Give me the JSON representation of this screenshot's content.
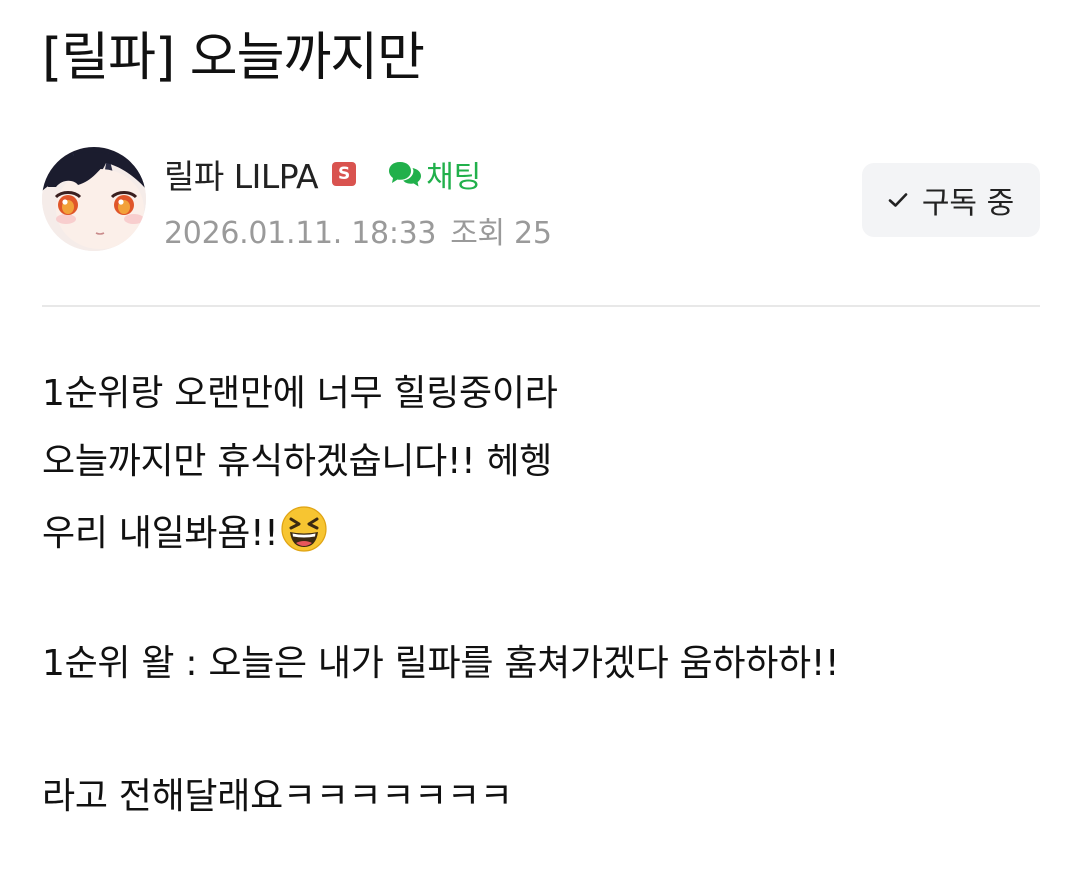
{
  "post": {
    "title": "[릴파] 오늘까지만",
    "author": {
      "name": "릴파 LILPA",
      "badge": "S",
      "badge_color": "#d9534f"
    },
    "chat_label": "채팅",
    "chat_color": "#21b04b",
    "date": "2026.01.11. 18:33",
    "views": "조회 25",
    "subscribe_label": "구독 중",
    "body": {
      "line1": "1순위랑 오랜만에 너무 힐링중이라",
      "line2": "오늘까지만 휴식하겠숩니다!! 헤헹",
      "line3": "우리 내일봐욤!!",
      "line3_emoji": "grinning-squinting-face-emoji",
      "line4": "1순위 왈 : 오늘은 내가 릴파를 훔쳐가겠다 움하하하!!",
      "line5": "라고 전해달래요ㅋㅋㅋㅋㅋㅋㅋ"
    }
  },
  "icons": {
    "chat": "speech-bubbles-icon",
    "check": "check-icon",
    "avatar": "profile-avatar"
  }
}
